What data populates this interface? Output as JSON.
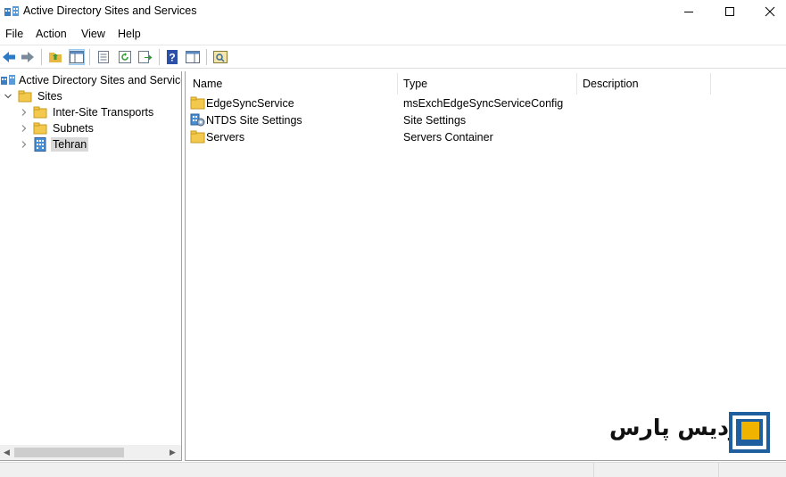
{
  "window": {
    "title": "Active Directory Sites and Services",
    "controls": [
      "minimize-icon",
      "maximize-icon",
      "close-icon"
    ]
  },
  "menu": {
    "items": [
      "File",
      "Action",
      "View",
      "Help"
    ]
  },
  "toolbar": {
    "buttons": [
      "back-arrow-icon",
      "forward-arrow-icon",
      "up-folder-icon",
      "show-hide-tree-icon",
      "properties-icon",
      "refresh-icon",
      "export-list-icon",
      "help-icon",
      "show-hide-action-pane-icon",
      "link-icon"
    ]
  },
  "tree": {
    "root": "Active Directory Sites and Services",
    "sites": "Sites",
    "children": [
      "Inter-Site Transports",
      "Subnets",
      "Tehran"
    ],
    "selected": "Tehran"
  },
  "list": {
    "columns": [
      "Name",
      "Type",
      "Description"
    ],
    "rows": [
      {
        "name": "EdgeSyncService",
        "type": "msExchEdgeSyncServiceConfig",
        "icon": "folder-icon"
      },
      {
        "name": "NTDS Site Settings",
        "type": "Site Settings",
        "icon": "ntds-settings-icon"
      },
      {
        "name": "Servers",
        "type": "Servers Container",
        "icon": "folder-icon"
      }
    ]
  },
  "watermark": {
    "text": "پردیس پارس"
  },
  "colors": {
    "folder": "#f2c94c",
    "selected_bg": "#d9d9d9",
    "pressed_bg": "#cce4f7",
    "logo_blue": "#1f5fa0",
    "logo_yellow": "#f0b400"
  }
}
